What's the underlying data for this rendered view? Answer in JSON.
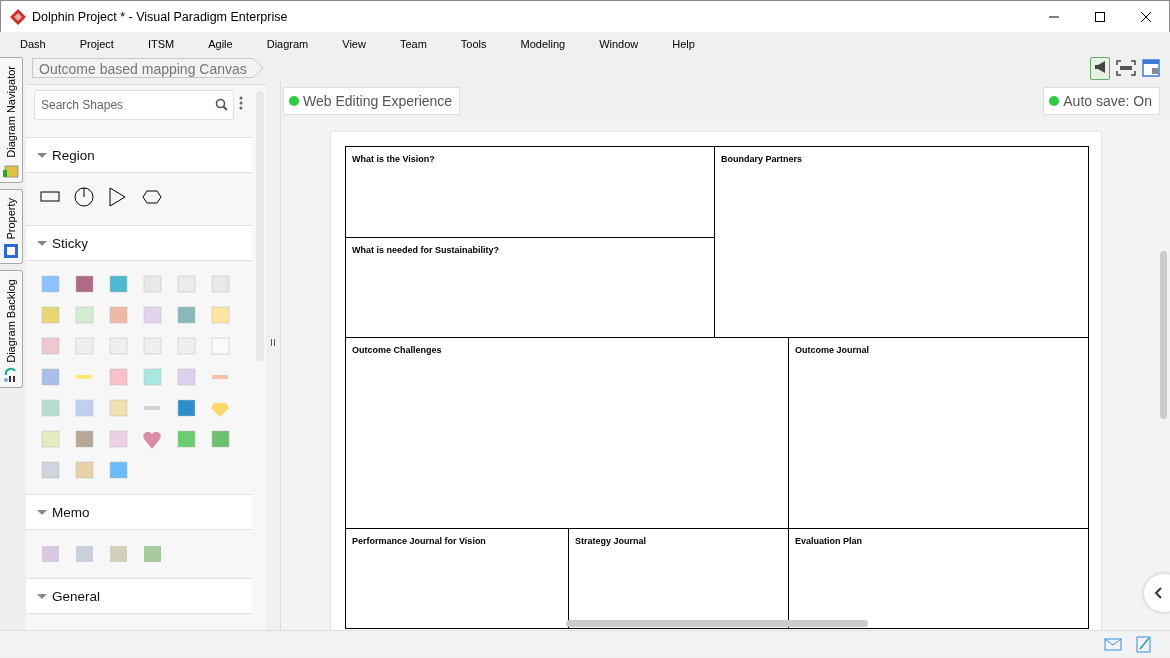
{
  "window": {
    "title": "Dolphin Project * - Visual Paradigm Enterprise"
  },
  "menu": [
    "Dash",
    "Project",
    "ITSM",
    "Agile",
    "Diagram",
    "View",
    "Team",
    "Tools",
    "Modeling",
    "Window",
    "Help"
  ],
  "side_tabs": [
    {
      "label": "Diagram Navigator"
    },
    {
      "label": "Property"
    },
    {
      "label": "Diagram Backlog"
    }
  ],
  "breadcrumb": "Outcome based mapping Canvas",
  "palette": {
    "search": {
      "placeholder": "Search Shapes"
    },
    "sections": [
      {
        "title": "Region",
        "expanded": true,
        "kind": "region"
      },
      {
        "title": "Sticky",
        "expanded": true,
        "kind": "sticky"
      },
      {
        "title": "Memo",
        "expanded": true,
        "kind": "memo"
      },
      {
        "title": "General",
        "expanded": true,
        "kind": "empty"
      }
    ]
  },
  "editor_badge": {
    "label": "Web Editing Experience",
    "color": "#2ecc40"
  },
  "autosave_badge": {
    "label": "Auto save: On",
    "color": "#2ecc40"
  },
  "canvas": {
    "cells": [
      "What is the Vision?",
      "Boundary Partners",
      "What is needed for Sustainability?",
      "Outcome Challenges",
      "Outcome Journal",
      "Performance Journal for Vision",
      "Strategy Journal",
      "Evaluation Plan"
    ]
  }
}
